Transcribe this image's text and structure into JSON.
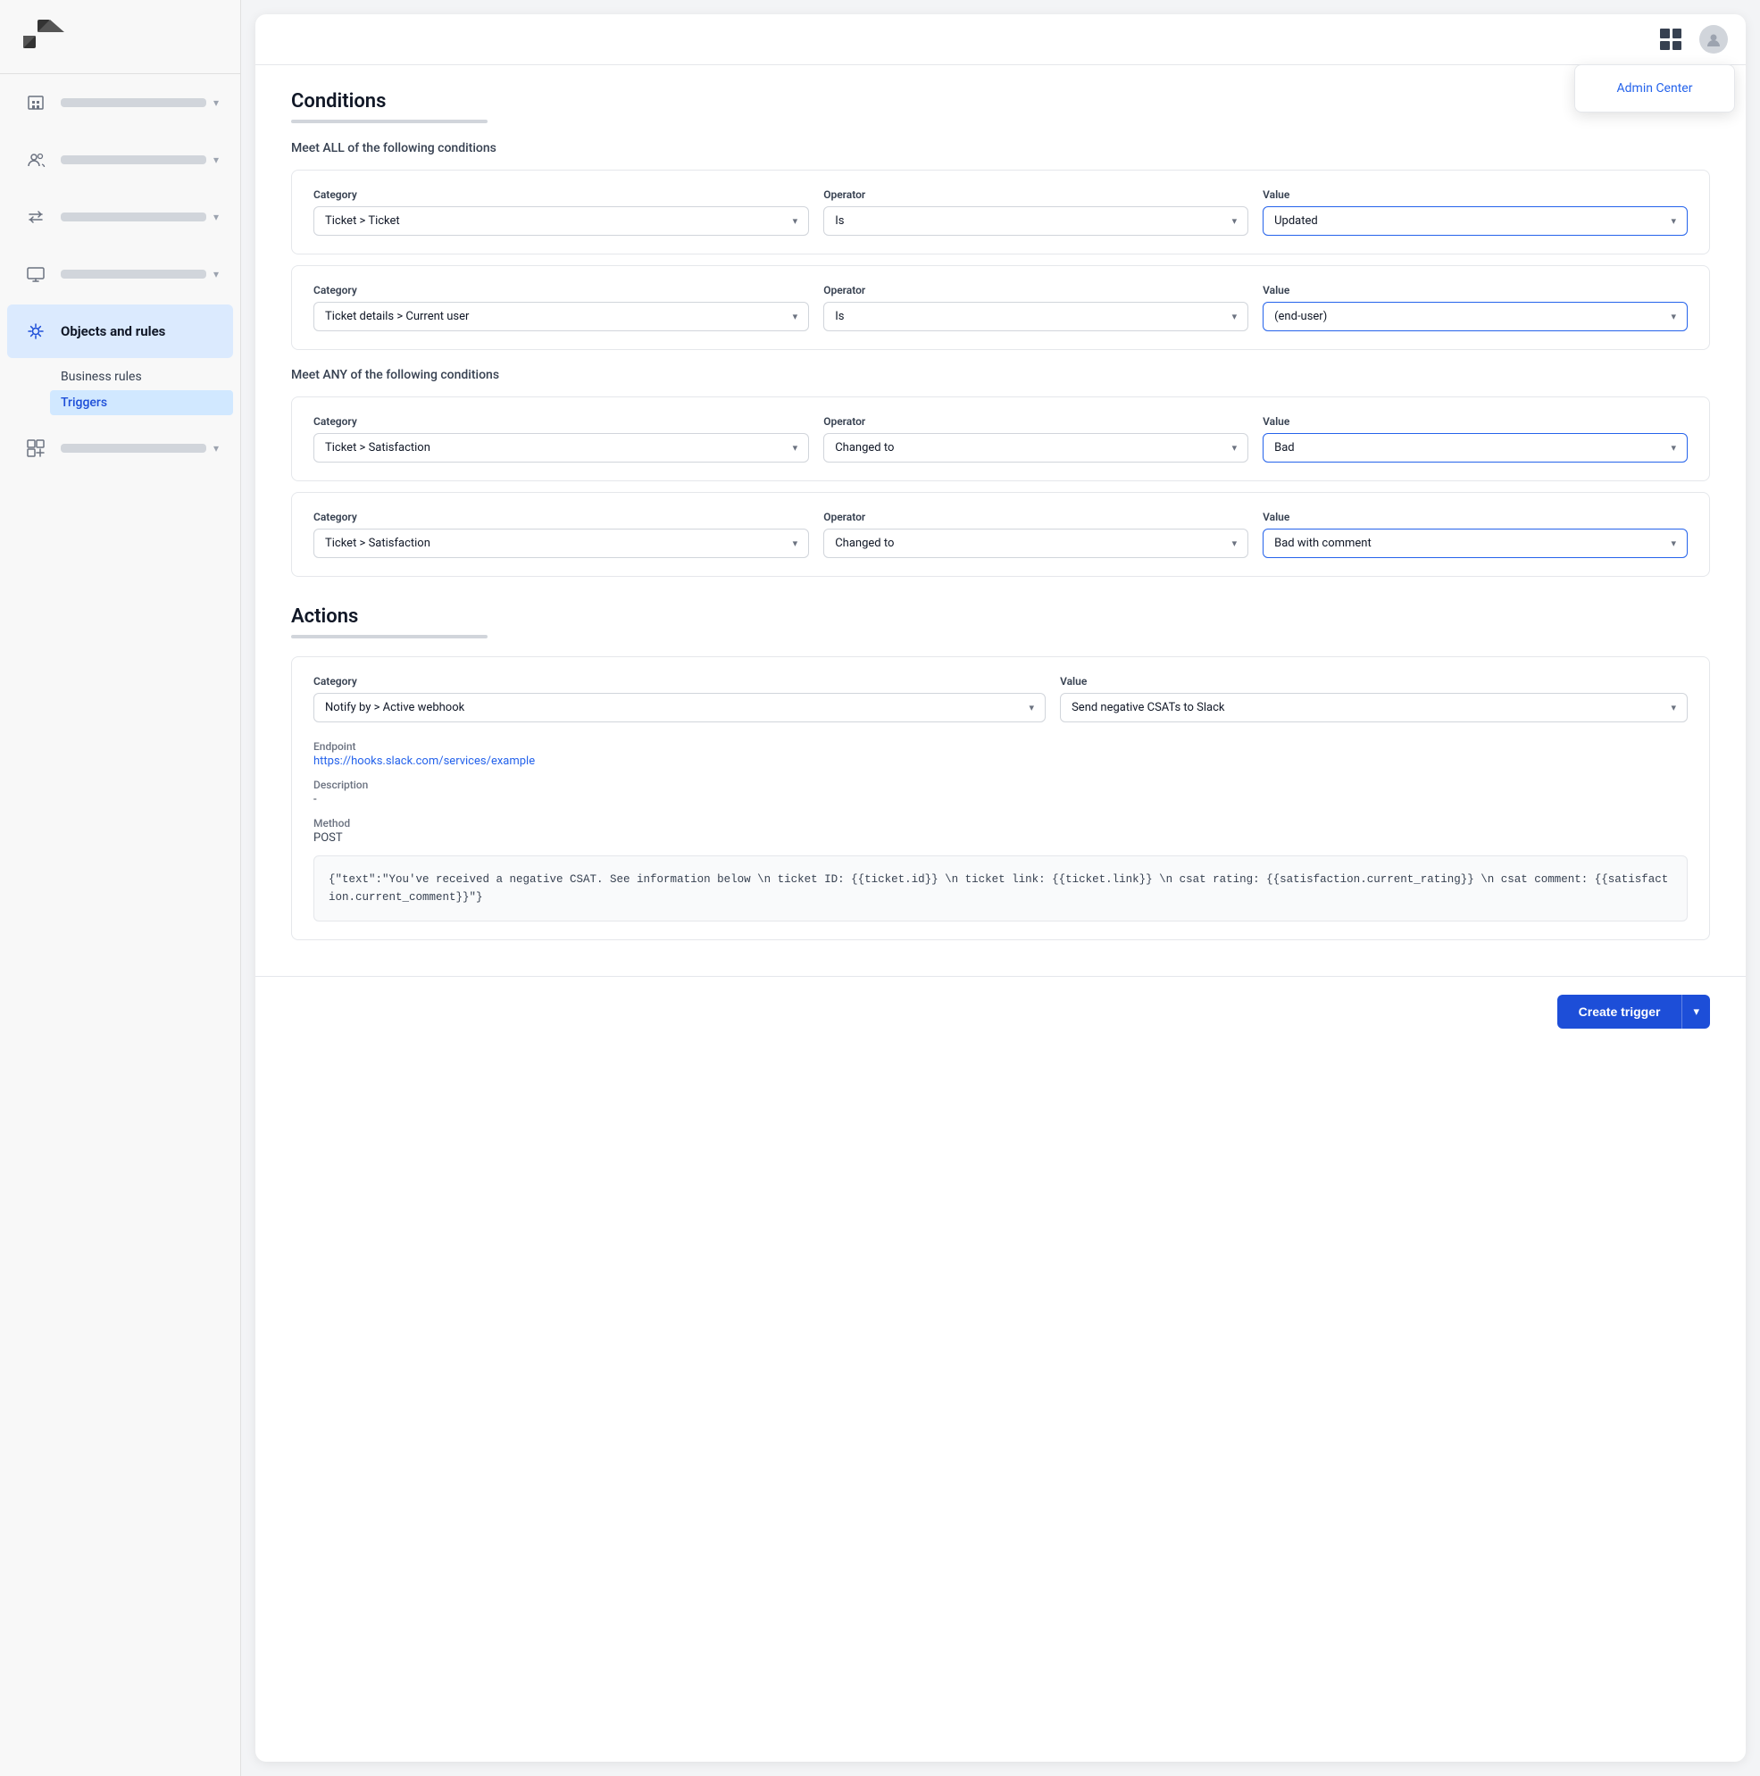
{
  "sidebar": {
    "nav_items": [
      {
        "id": "buildings",
        "icon": "🏢",
        "active": false
      },
      {
        "id": "people",
        "icon": "👥",
        "active": false
      },
      {
        "id": "arrows",
        "icon": "⇄",
        "active": false
      },
      {
        "id": "screen",
        "icon": "🖥",
        "active": false
      },
      {
        "id": "objects",
        "icon": "⚡",
        "label": "Objects and rules",
        "active": true
      },
      {
        "id": "apps",
        "icon": "⊞",
        "active": false
      }
    ],
    "sub_items": [
      {
        "id": "business-rules",
        "label": "Business rules",
        "active": false
      },
      {
        "id": "triggers",
        "label": "Triggers",
        "active": true
      }
    ]
  },
  "header": {
    "admin_center_label": "Admin Center"
  },
  "conditions": {
    "section_title": "Conditions",
    "meet_all_label": "Meet ALL of the following conditions",
    "meet_any_label": "Meet ANY of the following conditions",
    "all_conditions": [
      {
        "category_label": "Category",
        "category_value": "Ticket > Ticket",
        "operator_label": "Operator",
        "operator_value": "Is",
        "value_label": "Value",
        "value_value": "Updated",
        "value_highlighted": true
      },
      {
        "category_label": "Category",
        "category_value": "Ticket details > Current user",
        "operator_label": "Operator",
        "operator_value": "Is",
        "value_label": "Value",
        "value_value": "(end-user)",
        "value_highlighted": true
      }
    ],
    "any_conditions": [
      {
        "category_label": "Category",
        "category_value": "Ticket > Satisfaction",
        "operator_label": "Operator",
        "operator_value": "Changed to",
        "value_label": "Value",
        "value_value": "Bad",
        "value_highlighted": true
      },
      {
        "category_label": "Category",
        "category_value": "Ticket > Satisfaction",
        "operator_label": "Operator",
        "operator_value": "Changed to",
        "value_label": "Value",
        "value_value": "Bad with comment",
        "value_highlighted": true
      }
    ]
  },
  "actions": {
    "section_title": "Actions",
    "action_row": {
      "category_label": "Category",
      "category_value": "Notify by > Active webhook",
      "value_label": "Value",
      "value_value": "Send negative CSATs to Slack"
    },
    "endpoint_label": "Endpoint",
    "endpoint_value": "https://hooks.slack.com/services/example",
    "description_label": "Description",
    "description_value": "-",
    "method_label": "Method",
    "method_value": "POST",
    "code_value": "{\"text\":\"You've received a negative CSAT. See information below \\n ticket ID: {{ticket.id}} \\n ticket link: {{ticket.link}} \\n csat rating: {{satisfaction.current_rating}} \\n csat comment: {{satisfaction.current_comment}}\"}"
  },
  "bottom_bar": {
    "create_btn_label": "Create trigger"
  }
}
